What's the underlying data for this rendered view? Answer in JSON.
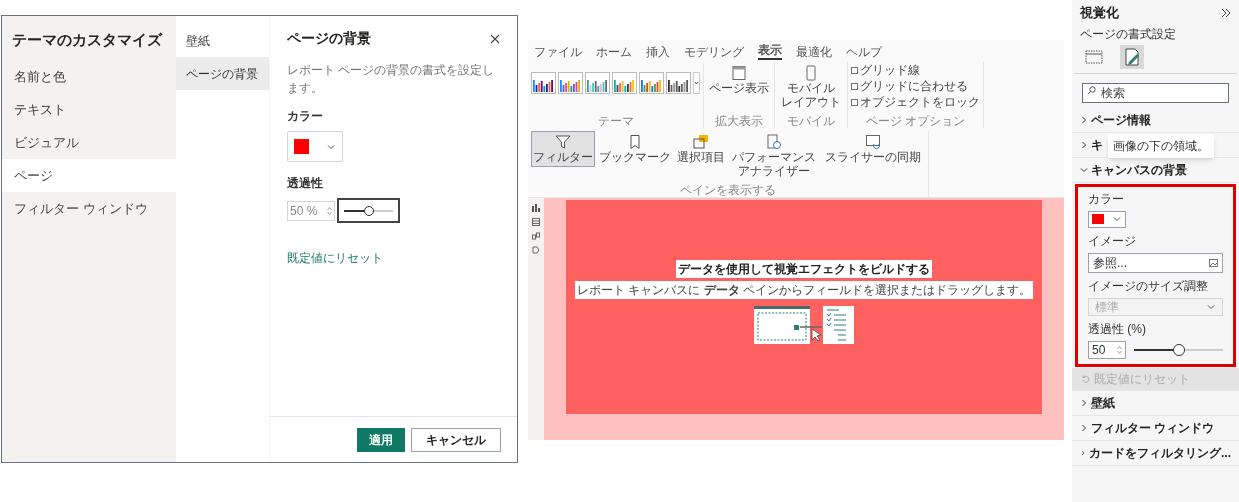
{
  "theme_dialog": {
    "title": "テーマのカスタマイズ",
    "nav_items": [
      {
        "label": "名前と色",
        "selected": false
      },
      {
        "label": "テキスト",
        "selected": false
      },
      {
        "label": "ビジュアル",
        "selected": false
      },
      {
        "label": "ページ",
        "selected": true
      },
      {
        "label": "フィルター ウィンドウ",
        "selected": false
      }
    ],
    "sub_items": [
      {
        "label": "壁紙",
        "selected": false
      },
      {
        "label": "ページの背景",
        "selected": true
      }
    ],
    "heading": "ページの背景",
    "description": "レポート ページの背景の書式を設定します。",
    "color_label": "カラー",
    "color": "#ff0000",
    "transparency_label": "透過性",
    "transparency_value": "50 %",
    "level": 0.5,
    "reset_link": "既定値にリセット",
    "buttons": [
      {
        "label": "適用",
        "kind": "primary"
      },
      {
        "label": "キャンセル",
        "kind": "secondary"
      }
    ]
  },
  "report_view": {
    "ribbon_tabs": [
      {
        "label": "ファイル",
        "selected": false
      },
      {
        "label": "ホーム",
        "selected": false
      },
      {
        "label": "挿入",
        "selected": false
      },
      {
        "label": "モデリング",
        "selected": false
      },
      {
        "label": "表示",
        "selected": true
      },
      {
        "label": "最適化",
        "selected": false
      },
      {
        "label": "ヘルプ",
        "selected": false
      }
    ],
    "ribbon_groups": [
      {
        "kind": "gallery",
        "label": "テーマ"
      },
      {
        "kind": "buttons",
        "label": "拡大表示",
        "buttons": [
          {
            "label": "ページ表示",
            "kind": "page",
            "selected": false
          }
        ]
      },
      {
        "kind": "buttons",
        "label": "モバイル",
        "buttons": [
          {
            "label_lines": [
              "モバイル",
              "レイアウト"
            ],
            "kind": "phone",
            "selected": false
          }
        ]
      },
      {
        "kind": "checks",
        "label": "ページ オプション",
        "checks": [
          {
            "label": "グリッド線",
            "checked": false
          },
          {
            "label": "グリッドに合わせる",
            "checked": false
          },
          {
            "label": "オブジェクトをロック",
            "checked": false
          }
        ]
      },
      {
        "kind": "buttons",
        "label": "ペインを表示する",
        "buttons": [
          {
            "label": "フィルター",
            "kind": "filter",
            "selected": true
          },
          {
            "label": "ブックマーク",
            "kind": "bookmark",
            "selected": false
          },
          {
            "label": "選択項目",
            "kind": "selection",
            "selected": false
          },
          {
            "label_lines": [
              "パフォーマンス",
              "アナライザー"
            ],
            "kind": "performance",
            "selected": false
          },
          {
            "label": "スライサーの同期",
            "kind": "sync",
            "selected": false
          }
        ]
      }
    ],
    "canvas": {
      "title": "データを使用して視覚エフェクトをビルドする",
      "subtitle": "レポート キャンバスに **データ** ペインからフィールドを選択またはドラッグします。"
    }
  },
  "visualizations_pane": {
    "title": "視覚化",
    "subtitle": "ページの書式設定",
    "format_tabs": [
      {
        "kind": "fields",
        "selected": false
      },
      {
        "kind": "format",
        "selected": true
      }
    ],
    "search_placeholder": "検索",
    "sections": [
      {
        "label": "ページ情報",
        "expanded": false
      },
      {
        "label": "キ",
        "expanded": false
      },
      {
        "label": "キャンバスの背景",
        "expanded": true
      },
      {
        "label": "壁紙",
        "expanded": false
      },
      {
        "label": "フィルター ウィンドウ",
        "expanded": false
      },
      {
        "label": "カードをフィルタリング...",
        "expanded": false
      }
    ],
    "tooltip": "画像の下の領域。",
    "canvas_background": {
      "highlighted": true,
      "color_label": "カラー",
      "color": "#ff0000",
      "image_label": "イメージ",
      "image_value": "参照...",
      "size_label": "イメージのサイズ調整",
      "size_value": "標準",
      "size_disabled": true,
      "transparency_label": "透過性 (%)",
      "transparency_value": "50",
      "level": 0.5,
      "reset": "既定値にリセット",
      "reset_disabled": true
    }
  }
}
